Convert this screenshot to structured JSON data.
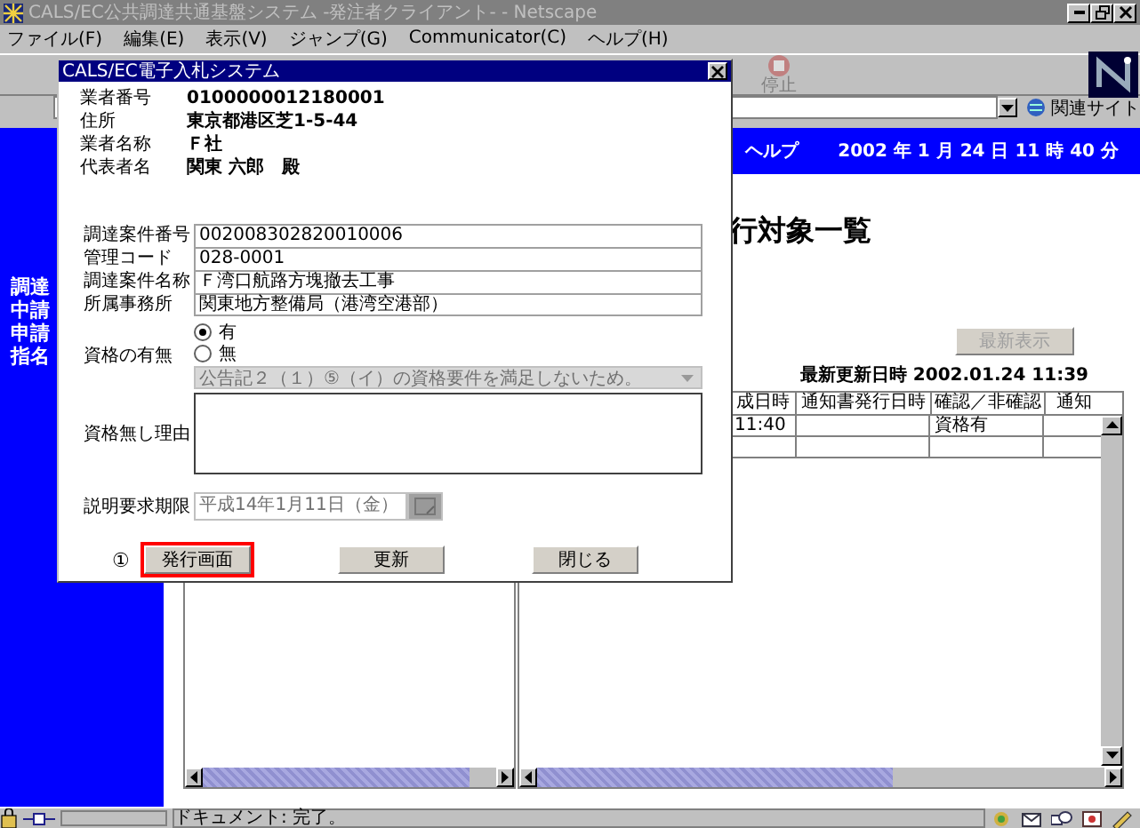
{
  "window": {
    "title": "CALS/EC公共調達共通基盤システム -発注者クライアント- - Netscape"
  },
  "menu": [
    "ファイル(F)",
    "編集(E)",
    "表示(V)",
    "ジャンプ(G)",
    "Communicator(C)",
    "ヘルプ(H)"
  ],
  "toolbar": {
    "stop_label": "停止"
  },
  "location_bar": {
    "related_label": "関連サイト"
  },
  "header_bar": {
    "help": "ヘルプ",
    "date": "2002 年 1 月 24 日 11 時 40 分"
  },
  "sidebar": {
    "items": [
      "調達",
      "中請",
      "申請",
      "指名"
    ]
  },
  "page_title": "行対象一覧",
  "refresh_button": {
    "label": "最新表示",
    "disabled": true
  },
  "last_updated": "最新更新日時 2002.01.24 11:39",
  "table": {
    "columns": [
      "成日時",
      "通知書発行日時",
      "確認／非確認",
      "通知"
    ],
    "rows": [
      {
        "cells": [
          "11:40",
          null,
          "資格有",
          null
        ]
      }
    ]
  },
  "status_bar": {
    "text": "ドキュメント: 完了。"
  },
  "dialog": {
    "title": "CALS/EC電子入札システム",
    "info": [
      {
        "label": "業者番号",
        "value": "0100000012180001"
      },
      {
        "label": "住所",
        "value": "東京都港区芝1-5-44"
      },
      {
        "label": "業者名称",
        "value": "Ｆ社"
      },
      {
        "label": "代表者名",
        "value": "関東 六郎　殿"
      }
    ],
    "project": [
      {
        "label": "調達案件番号",
        "value": "002008302820010006"
      },
      {
        "label": "管理コード",
        "value": "028-0001"
      },
      {
        "label": "調達案件名称",
        "value": "Ｆ湾口航路方塊撤去工事"
      },
      {
        "label": "所属事務所",
        "value": "関東地方整備局（港湾空港部）"
      }
    ],
    "qualification": {
      "label": "資格の有無",
      "options": [
        {
          "label": "有",
          "selected": true
        },
        {
          "label": "無",
          "selected": false
        }
      ],
      "reason_select": {
        "value": "公告記２（１）⑤（イ）の資格要件を満足しないため。",
        "disabled": true
      }
    },
    "reason": {
      "label": "資格無し理由"
    },
    "deadline": {
      "label": "説明要求期限",
      "value": "平成14年1月11日（金）",
      "disabled": true
    },
    "annotation": "①",
    "buttons": [
      {
        "label": "発行画面",
        "highlighted": true
      },
      {
        "label": "更新",
        "highlighted": false
      },
      {
        "label": "閉じる",
        "highlighted": false
      }
    ]
  }
}
